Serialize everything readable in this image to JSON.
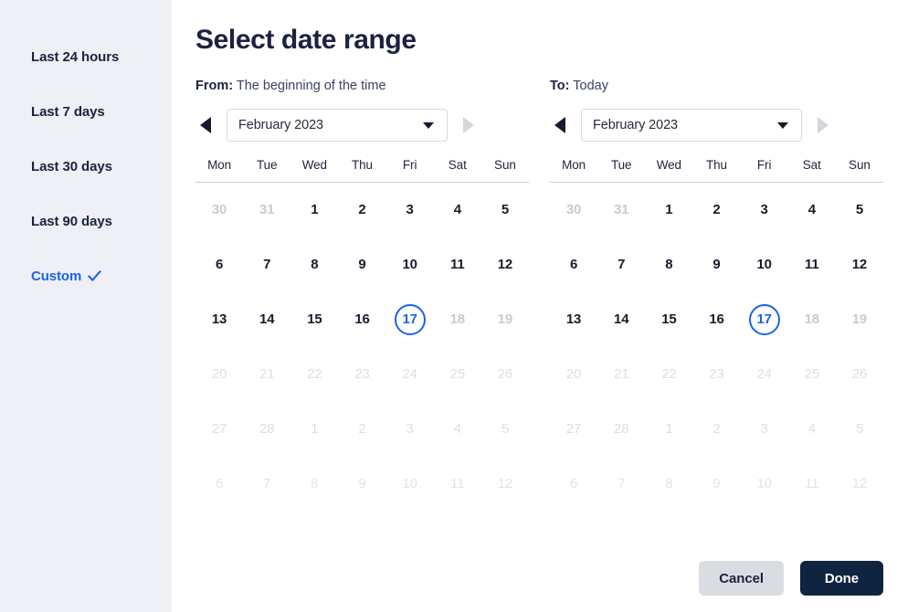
{
  "title": "Select date range",
  "sidebar": {
    "items": [
      {
        "label": "Last 24 hours",
        "active": false
      },
      {
        "label": "Last 7 days",
        "active": false
      },
      {
        "label": "Last 30 days",
        "active": false
      },
      {
        "label": "Last 90 days",
        "active": false
      },
      {
        "label": "Custom",
        "active": true
      }
    ]
  },
  "from": {
    "label": "From:",
    "value": "The beginning of the time",
    "month_label": "February 2023",
    "prev_arrow": "prev-month-arrow",
    "next_arrow": "next-month-arrow",
    "next_disabled": true
  },
  "to": {
    "label": "To:",
    "value": "Today",
    "month_label": "February 2023",
    "prev_arrow": "prev-month-arrow",
    "next_arrow": "next-month-arrow",
    "next_disabled": true
  },
  "weekdays": [
    "Mon",
    "Tue",
    "Wed",
    "Thu",
    "Fri",
    "Sat",
    "Sun"
  ],
  "calendar": {
    "selected_day": 17,
    "weeks": [
      [
        {
          "n": 30,
          "state": "muted"
        },
        {
          "n": 31,
          "state": "muted"
        },
        {
          "n": 1,
          "state": "normal"
        },
        {
          "n": 2,
          "state": "normal"
        },
        {
          "n": 3,
          "state": "normal"
        },
        {
          "n": 4,
          "state": "normal"
        },
        {
          "n": 5,
          "state": "normal"
        }
      ],
      [
        {
          "n": 6,
          "state": "normal"
        },
        {
          "n": 7,
          "state": "normal"
        },
        {
          "n": 8,
          "state": "normal"
        },
        {
          "n": 9,
          "state": "normal"
        },
        {
          "n": 10,
          "state": "normal"
        },
        {
          "n": 11,
          "state": "normal"
        },
        {
          "n": 12,
          "state": "normal"
        }
      ],
      [
        {
          "n": 13,
          "state": "normal"
        },
        {
          "n": 14,
          "state": "normal"
        },
        {
          "n": 15,
          "state": "normal"
        },
        {
          "n": 16,
          "state": "normal"
        },
        {
          "n": 17,
          "state": "selected"
        },
        {
          "n": 18,
          "state": "muted"
        },
        {
          "n": 19,
          "state": "muted"
        }
      ],
      [
        {
          "n": 20,
          "state": "faint"
        },
        {
          "n": 21,
          "state": "faint"
        },
        {
          "n": 22,
          "state": "faint"
        },
        {
          "n": 23,
          "state": "faint"
        },
        {
          "n": 24,
          "state": "faint"
        },
        {
          "n": 25,
          "state": "faint"
        },
        {
          "n": 26,
          "state": "faint"
        }
      ],
      [
        {
          "n": 27,
          "state": "faint"
        },
        {
          "n": 28,
          "state": "faint"
        },
        {
          "n": 1,
          "state": "faint"
        },
        {
          "n": 2,
          "state": "faint"
        },
        {
          "n": 3,
          "state": "faint"
        },
        {
          "n": 4,
          "state": "faint"
        },
        {
          "n": 5,
          "state": "faint"
        }
      ],
      [
        {
          "n": 6,
          "state": "faintest"
        },
        {
          "n": 7,
          "state": "faintest"
        },
        {
          "n": 8,
          "state": "faintest"
        },
        {
          "n": 9,
          "state": "faintest"
        },
        {
          "n": 10,
          "state": "faintest"
        },
        {
          "n": 11,
          "state": "faintest"
        },
        {
          "n": 12,
          "state": "faintest"
        }
      ]
    ]
  },
  "footer": {
    "cancel_label": "Cancel",
    "done_label": "Done"
  },
  "colors": {
    "accent": "#1a62ef",
    "sidebar_bg": "#eef0f5",
    "text": "#1b2240",
    "done_bg": "#0f2440",
    "cancel_bg": "#d9dce1",
    "disabled": "#c8cbd2"
  }
}
